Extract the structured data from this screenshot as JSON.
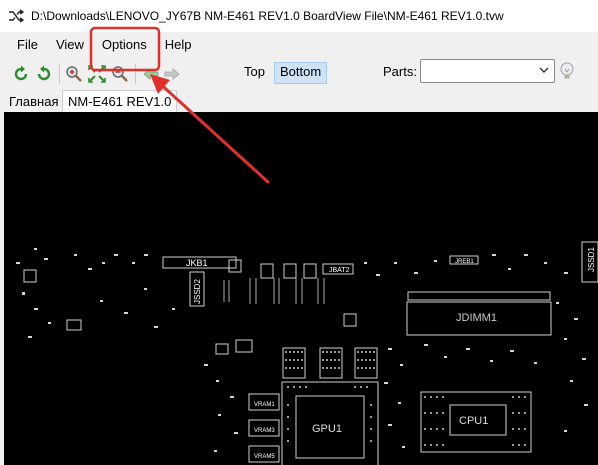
{
  "window": {
    "title": "D:\\Downloads\\LENOVO_JY67B NM-E461 REV1.0 BoardView File\\NM-E461 REV1.0.tvw"
  },
  "menu": {
    "items": [
      "File",
      "View",
      "Options",
      "Help"
    ]
  },
  "toolbar": {
    "side_top": "Top",
    "side_bottom": "Bottom",
    "parts_label": "Parts:",
    "parts_value": ""
  },
  "tabs": {
    "items": [
      "Главная",
      "NM-E461 REV1.0"
    ],
    "active_index": 1
  },
  "board": {
    "labels": [
      "JKB1",
      "JSSD2",
      "JBAT2",
      "JREB1",
      "JDIMM1",
      "JSSD1",
      "GPU1",
      "CPU1",
      "VRAM1",
      "VRAM3",
      "VRAM5"
    ]
  },
  "colors": {
    "annotation": "#e0302c",
    "board_background": "#000000",
    "part_outline": "#d0d0d0",
    "accent": "#cfe3f6"
  },
  "icons": [
    "shuffle-icon",
    "rotate-left-icon",
    "rotate-right-icon",
    "zoom-in-icon",
    "zoom-fit-icon",
    "zoom-out-icon",
    "arrow-left-icon",
    "arrow-right-icon",
    "chevron-down-icon",
    "lightbulb-icon"
  ]
}
